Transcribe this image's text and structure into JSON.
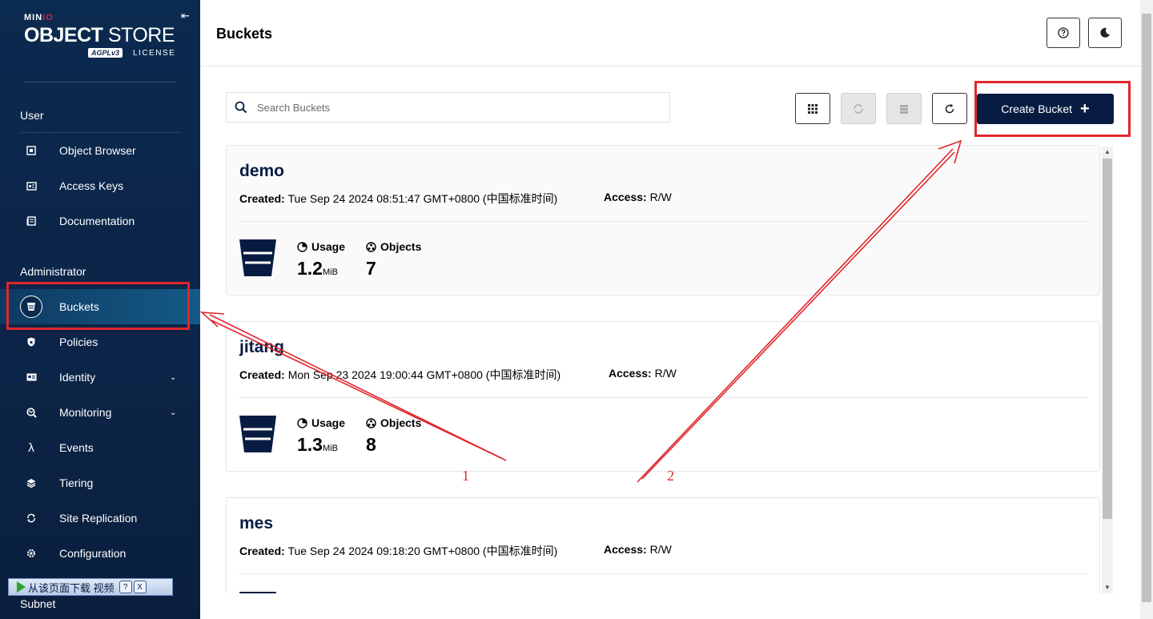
{
  "sidebar": {
    "logo": {
      "brand_min": "MIN",
      "brand_io": "IO",
      "product_bold": "OBJECT",
      "product_rest": " STORE",
      "agpl": "AGPLv3",
      "license": "LICENSE"
    },
    "sections": [
      {
        "title": "User"
      },
      {
        "title": "Administrator"
      }
    ],
    "user_items": [
      {
        "label": "Object Browser",
        "icon": "object-browser-icon"
      },
      {
        "label": "Access Keys",
        "icon": "access-keys-icon"
      },
      {
        "label": "Documentation",
        "icon": "documentation-icon"
      }
    ],
    "admin_items": [
      {
        "label": "Buckets",
        "icon": "bucket-icon",
        "active": true
      },
      {
        "label": "Policies",
        "icon": "policy-shield-icon"
      },
      {
        "label": "Identity",
        "icon": "identity-icon",
        "expandable": true
      },
      {
        "label": "Monitoring",
        "icon": "monitoring-icon",
        "expandable": true
      },
      {
        "label": "Events",
        "icon": "lambda-icon"
      },
      {
        "label": "Tiering",
        "icon": "layers-icon"
      },
      {
        "label": "Site Replication",
        "icon": "replication-icon"
      },
      {
        "label": "Configuration",
        "icon": "gear-icon"
      }
    ],
    "subnet": "Subnet",
    "download_bar": {
      "text": "从该页面下载 视频",
      "help": "?",
      "close": "X"
    }
  },
  "header": {
    "title": "Buckets"
  },
  "search": {
    "placeholder": "Search Buckets"
  },
  "toolbar": {
    "create_label": "Create Bucket"
  },
  "buckets": [
    {
      "name": "demo",
      "created_label": "Created:",
      "created": "Tue Sep 24 2024 08:51:47 GMT+0800 (中国标准时间)",
      "access_label": "Access:",
      "access": "R/W",
      "usage_label": "Usage",
      "usage": "1.2",
      "usage_unit": "MiB",
      "objects_label": "Objects",
      "objects": "7"
    },
    {
      "name": "jitang",
      "created_label": "Created:",
      "created": "Mon Sep 23 2024 19:00:44 GMT+0800 (中国标准时间)",
      "access_label": "Access:",
      "access": "R/W",
      "usage_label": "Usage",
      "usage": "1.3",
      "usage_unit": "MiB",
      "objects_label": "Objects",
      "objects": "8"
    },
    {
      "name": "mes",
      "created_label": "Created:",
      "created": "Tue Sep 24 2024 09:18:20 GMT+0800 (中国标准时间)",
      "access_label": "Access:",
      "access": "R/W"
    }
  ],
  "annotations": {
    "arrow1": "1",
    "arrow2": "2"
  },
  "colors": {
    "sidebar": "#0b2a4f",
    "primary": "#081c42",
    "annotation": "#e0262c"
  }
}
